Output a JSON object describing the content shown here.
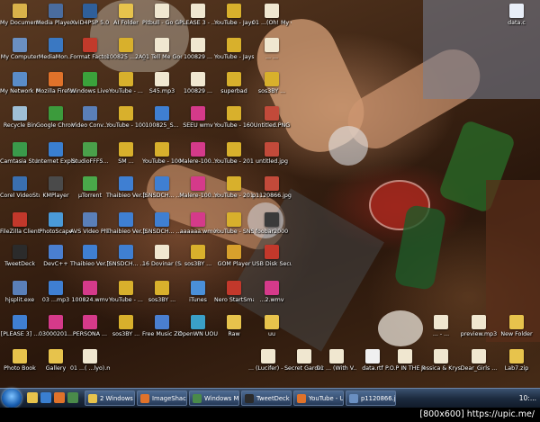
{
  "desktop_icons": [
    {
      "label": "My Documents",
      "icon": "folder-icon",
      "color": "#d9b24a"
    },
    {
      "label": "Media Player Classic",
      "icon": "media-player-icon",
      "color": "#4a6c9e"
    },
    {
      "label": "XviD4PSP 5.0",
      "icon": "video-converter-icon",
      "color": "#2f5f9a"
    },
    {
      "label": "AI Folder",
      "icon": "folder-icon",
      "color": "#e7c34c"
    },
    {
      "label": "Pitbull - Go Girl.mp3",
      "icon": "audio-file-icon",
      "color": "#f0e7d0"
    },
    {
      "label": "PLEASE 3 - ...",
      "icon": "audio-file-icon",
      "color": "#f0e7d0"
    },
    {
      "label": "YouTube - Jays2735 S...",
      "icon": "video-file-icon",
      "color": "#d8b02c"
    },
    {
      "label": "01 ...(Oh! My G...",
      "icon": "audio-file-icon",
      "color": "#f0e7d0"
    },
    {
      "label": "My Computer",
      "icon": "computer-icon",
      "color": "#6a8fc1"
    },
    {
      "label": "MediaMon...",
      "icon": "media-monkey-icon",
      "color": "#3a78c2"
    },
    {
      "label": "Format Factory",
      "icon": "format-factory-icon",
      "color": "#c23a2b"
    },
    {
      "label": "100825 ...2A_...",
      "icon": "video-file-icon",
      "color": "#d8b02c"
    },
    {
      "label": "01 Tell Me Goodbye...",
      "icon": "audio-file-icon",
      "color": "#f0e7d0"
    },
    {
      "label": "100829 ...",
      "icon": "audio-file-icon",
      "color": "#f0e7d0"
    },
    {
      "label": "YouTube - Jays2735 S...",
      "icon": "video-file-icon",
      "color": "#d8b02c"
    },
    {
      "label": "... ...",
      "icon": "audio-file-icon",
      "color": "#f0e7d0"
    },
    {
      "label": "My Network Places",
      "icon": "network-icon",
      "color": "#5a8cc8"
    },
    {
      "label": "Mozilla Firefox",
      "icon": "firefox-icon",
      "color": "#e0722a"
    },
    {
      "label": "Windows Live Mess...",
      "icon": "messenger-icon",
      "color": "#3ba23b"
    },
    {
      "label": "YouTube - ...",
      "icon": "video-file-icon",
      "color": "#d8b02c"
    },
    {
      "label": "S45.mp3",
      "icon": "audio-file-icon",
      "color": "#f0e7d0"
    },
    {
      "label": "100829 ...",
      "icon": "audio-file-icon",
      "color": "#f0e7d0"
    },
    {
      "label": "superbad",
      "icon": "video-file-icon",
      "color": "#d8b02c"
    },
    {
      "label": "sos3BY ...",
      "icon": "video-file-icon",
      "color": "#d8b02c"
    },
    {
      "label": "Recycle Bin",
      "icon": "recycle-bin-icon",
      "color": "#9fbfd6"
    },
    {
      "label": "Google Chrome",
      "icon": "chrome-icon",
      "color": "#3c9b3c"
    },
    {
      "label": "Video Conv...",
      "icon": "video-converter-icon",
      "color": "#5a7fb8"
    },
    {
      "label": "YouTube - 100821...",
      "icon": "video-file-icon",
      "color": "#d8b02c"
    },
    {
      "label": "100825_S...",
      "icon": "image-file-icon",
      "color": "#3f7fd2"
    },
    {
      "label": "SEEU wmv",
      "icon": "media-file-icon",
      "color": "#d53a8a"
    },
    {
      "label": "YouTube - 16019684...",
      "icon": "video-file-icon",
      "color": "#d8b02c"
    },
    {
      "label": "Untitled.PNG",
      "icon": "image-file-icon",
      "color": "#c24a3a"
    },
    {
      "label": "Camtasia Studio 4",
      "icon": "camtasia-icon",
      "color": "#3a9a4a"
    },
    {
      "label": "Internet Explorer",
      "icon": "ie-icon",
      "color": "#3a7fd0"
    },
    {
      "label": "StudioFFFS...",
      "icon": "video-converter-icon",
      "color": "#4aa04a"
    },
    {
      "label": "SM ...",
      "icon": "video-file-icon",
      "color": "#d8b02c"
    },
    {
      "label": "YouTube - 100821...",
      "icon": "video-file-icon",
      "color": "#d8b02c"
    },
    {
      "label": "Malere-100...",
      "icon": "media-file-icon",
      "color": "#d53a8a"
    },
    {
      "label": "YouTube - 20100828...",
      "icon": "video-file-icon",
      "color": "#d8b02c"
    },
    {
      "label": "untitled.jpg",
      "icon": "image-file-icon",
      "color": "#c24a3a"
    },
    {
      "label": "Corel VideoStu...",
      "icon": "corel-icon",
      "color": "#3a6fb0"
    },
    {
      "label": "KMPlayer",
      "icon": "kmplayer-icon",
      "color": "#4a4a4a"
    },
    {
      "label": "µTorrent",
      "icon": "utorrent-icon",
      "color": "#4aa84a"
    },
    {
      "label": "Thaibieo Ver.3 R...",
      "icon": "image-file-icon",
      "color": "#3f7fd2"
    },
    {
      "label": "[SNSDCH... ...",
      "icon": "image-file-icon",
      "color": "#3f7fd2"
    },
    {
      "label": "Malere-100...",
      "icon": "media-file-icon",
      "color": "#d53a8a"
    },
    {
      "label": "YouTube - 20100828...",
      "icon": "video-file-icon",
      "color": "#d8b02c"
    },
    {
      "label": "p1120866.jpg",
      "icon": "image-file-icon",
      "color": "#c24a3a"
    },
    {
      "label": "FileZilla Client",
      "icon": "filezilla-icon",
      "color": "#c2382b"
    },
    {
      "label": "PhotoScape",
      "icon": "photoscape-icon",
      "color": "#4a9ad8"
    },
    {
      "label": "AVS Video Photo...",
      "icon": "avs-icon",
      "color": "#5a7fb8"
    },
    {
      "label": "Thaibieo Ver.3 R...",
      "icon": "image-file-icon",
      "color": "#3f7fd2"
    },
    {
      "label": "[SNSDCH... ...",
      "icon": "image-file-icon",
      "color": "#3f7fd2"
    },
    {
      "label": "aaaaaa.wmv",
      "icon": "media-file-icon",
      "color": "#d53a8a"
    },
    {
      "label": "YouTube - SNSD 10...",
      "icon": "video-file-icon",
      "color": "#d8b02c"
    },
    {
      "label": "foobar2000",
      "icon": "foobar-icon",
      "color": "#3a3a3a"
    },
    {
      "label": "TweetDeck",
      "icon": "tweetdeck-icon",
      "color": "#2b2b2b"
    },
    {
      "label": "DevC++",
      "icon": "devcpp-icon",
      "color": "#4a7fd0"
    },
    {
      "label": "Thaibieo Ver.3 RU...",
      "icon": "image-file-icon",
      "color": "#3f7fd2"
    },
    {
      "label": "[SNSDCH... ...",
      "icon": "image-file-icon",
      "color": "#3f7fd2"
    },
    {
      "label": "16 Dovinar (Say ITH...",
      "icon": "audio-file-icon",
      "color": "#f0e7d0"
    },
    {
      "label": "sos3BY ...",
      "icon": "video-file-icon",
      "color": "#d8b02c"
    },
    {
      "label": "GOM Player",
      "icon": "gom-player-icon",
      "color": "#d8a02c"
    },
    {
      "label": "USB Disk Security",
      "icon": "usb-security-icon",
      "color": "#c2382b"
    },
    {
      "label": "hjsplit.exe",
      "icon": "app-icon",
      "color": "#5a7fb8"
    },
    {
      "label": "03 ...mp3",
      "icon": "image-file-icon",
      "color": "#3f7fd2"
    },
    {
      "label": "100824.wmv",
      "icon": "media-file-icon",
      "color": "#d53a8a"
    },
    {
      "label": "YouTube - ...",
      "icon": "video-file-icon",
      "color": "#d8b02c"
    },
    {
      "label": "sos3BY ...",
      "icon": "video-file-icon",
      "color": "#d8b02c"
    },
    {
      "label": "iTunes",
      "icon": "itunes-icon",
      "color": "#4a8fd8"
    },
    {
      "label": "Nero StartSmart",
      "icon": "nero-icon",
      "color": "#c2382b"
    },
    {
      "label": "...2.wmv",
      "icon": "media-file-icon",
      "color": "#d53a8a"
    },
    {
      "label": "[PLEASE 3] ...",
      "icon": "image-file-icon",
      "color": "#3f7fd2"
    },
    {
      "label": "03000201...",
      "icon": "media-file-icon",
      "color": "#d53a8a"
    },
    {
      "label": "PERSONA ...",
      "icon": "media-file-icon",
      "color": "#d53a8a"
    },
    {
      "label": "sos3BY ...",
      "icon": "video-file-icon",
      "color": "#d8b02c"
    },
    {
      "label": "Free Music Zilla",
      "icon": "music-zilla-icon",
      "color": "#4a7fd0"
    },
    {
      "label": "OpenWN UOU",
      "icon": "app-icon",
      "color": "#3aa0c8"
    },
    {
      "label": "Raw",
      "icon": "folder-icon",
      "color": "#e7c34c"
    },
    {
      "label": "uu",
      "icon": "folder-icon",
      "color": "#e7c34c"
    },
    {
      "label": "Photo Book",
      "icon": "folder-icon",
      "color": "#e7c34c"
    },
    {
      "label": "Gallery",
      "icon": "folder-icon",
      "color": "#e7c34c"
    },
    {
      "label": "01 ...( ...lyo).mp3",
      "icon": "audio-file-icon",
      "color": "#f0e7d0"
    },
    {
      "label": "... (Lucifer) - ...",
      "icon": "audio-file-icon",
      "color": "#f0e7d0"
    },
    {
      "label": "Secret Garden - ...",
      "icon": "audio-file-icon",
      "color": "#f0e7d0"
    },
    {
      "label": "01 ... (With V...",
      "icon": "audio-file-icon",
      "color": "#f0e7d0"
    },
    {
      "label": "data.rtf",
      "icon": "document-file-icon",
      "color": "#f0f0f0"
    },
    {
      "label": "P.O.P IN THE ROO...",
      "icon": "audio-file-icon",
      "color": "#f0e7d0"
    },
    {
      "label": "Jessica & Krystal - ...",
      "icon": "audio-file-icon",
      "color": "#f0e7d0"
    },
    {
      "label": "Dear_Girls ...",
      "icon": "audio-file-icon",
      "color": "#f0e7d0"
    },
    {
      "label": "Lab7.zip",
      "icon": "archive-file-icon",
      "color": "#e7c34c"
    },
    {
      "label": "data.c",
      "icon": "c-file-icon",
      "color": "#e8eef8"
    },
    {
      "label": "... - ...",
      "icon": "audio-file-icon",
      "color": "#f0e7d0"
    },
    {
      "label": "preview.mp3",
      "icon": "audio-file-icon",
      "color": "#f0e7d0"
    },
    {
      "label": "New Folder",
      "icon": "folder-icon",
      "color": "#e7c34c"
    }
  ],
  "taskbar": {
    "items": [
      {
        "label": "2 Windows L...",
        "icon": "explorer-icon",
        "color": "#e7c34c"
      },
      {
        "label": "ImageShack® ...",
        "icon": "firefox-icon",
        "color": "#e0722a"
      },
      {
        "label": "Windows Medi...",
        "icon": "media-player-icon",
        "color": "#4a8a4a"
      },
      {
        "label": "TweetDeck",
        "icon": "tweetdeck-icon",
        "color": "#2b2b2b"
      },
      {
        "label": "YouTube - Upl...",
        "icon": "video-icon",
        "color": "#e0722a"
      },
      {
        "label": "p1120866.jpg ...",
        "icon": "image-viewer-icon",
        "color": "#6a8fc1"
      }
    ],
    "clock": "10:..."
  },
  "credit": "[800x600] https://upic.me/"
}
